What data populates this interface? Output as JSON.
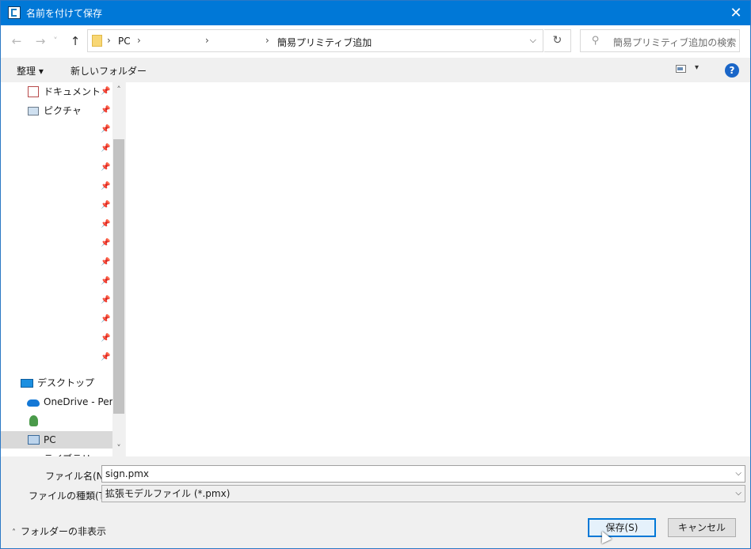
{
  "window": {
    "title": "名前を付けて保存",
    "close_glyph": "✕"
  },
  "nav": {
    "back_glyph": "←",
    "forward_glyph": "→",
    "recent_glyph": "˅",
    "up_glyph": "↑",
    "breadcrumb": [
      "PC",
      "",
      "",
      "簡易プリミティブ追加"
    ],
    "separator": "›",
    "dropdown_glyph": "⌵",
    "refresh_glyph": "↻",
    "search_placeholder": "簡易プリミティブ追加の検索",
    "search_glyph": "⚲"
  },
  "toolbar": {
    "organize_label": "整理 ▾",
    "new_folder_label": "新しいフォルダー",
    "view_drop_glyph": "▾",
    "help_glyph": "?"
  },
  "sidebar": {
    "pin_glyph": "📌",
    "quick_items": [
      {
        "label": "ドキュメント",
        "icon": "document-icon"
      },
      {
        "label": "ピクチャ",
        "icon": "pictures-icon"
      },
      {
        "label": ""
      },
      {
        "label": ""
      },
      {
        "label": ""
      },
      {
        "label": ""
      },
      {
        "label": ""
      },
      {
        "label": ""
      },
      {
        "label": ""
      },
      {
        "label": ""
      },
      {
        "label": ""
      },
      {
        "label": ""
      },
      {
        "label": ""
      },
      {
        "label": ""
      },
      {
        "label": ""
      }
    ],
    "items": [
      {
        "label": "デスクトップ",
        "icon": "desktop-icon"
      },
      {
        "label": "OneDrive - Persc",
        "icon": "onedrive-cloud-icon"
      },
      {
        "label": "",
        "icon": "user-icon"
      },
      {
        "label": "PC",
        "icon": "pc-icon",
        "selected": true
      },
      {
        "label": "ライブラリ",
        "icon": "library-icon"
      }
    ],
    "scroll_up_glyph": "˄",
    "scroll_down_glyph": "˅"
  },
  "form": {
    "filename_label": "ファイル名(N):",
    "filename_value": "sign.pmx",
    "filetype_label": "ファイルの種類(T):",
    "filetype_value": "拡張モデルファイル (*.pmx)",
    "dropdown_glyph": "⌵"
  },
  "footer": {
    "hide_folders_label": "フォルダーの非表示",
    "hide_folders_glyph": "˄",
    "save_label": "保存(S)",
    "cancel_label": "キャンセル"
  },
  "colors": {
    "titlebar": "#0078d7",
    "accent": "#0078d7",
    "selection": "#d9d9d9"
  }
}
